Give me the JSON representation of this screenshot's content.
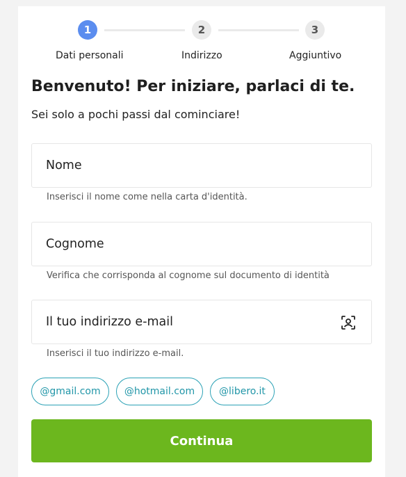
{
  "stepper": {
    "steps": [
      {
        "number": "1",
        "label": "Dati personali"
      },
      {
        "number": "2",
        "label": "Indirizzo"
      },
      {
        "number": "3",
        "label": "Aggiuntivo"
      }
    ],
    "active_step": 1
  },
  "heading": {
    "title": "Benvenuto! Per iniziare, parlaci di te.",
    "subtitle": "Sei solo a pochi passi dal cominciare!"
  },
  "form": {
    "first_name": {
      "placeholder": "Nome",
      "value": "",
      "helper": "Inserisci il nome come nella carta d'identità."
    },
    "last_name": {
      "placeholder": "Cognome",
      "value": "",
      "helper": "Verifica che corrisponda al cognome sul documento di identità"
    },
    "email": {
      "placeholder": "Il tuo indirizzo e-mail",
      "value": "",
      "helper": "Inserisci il tuo indirizzo e-mail.",
      "icon": "contact-icon"
    }
  },
  "email_domains": [
    "@gmail.com",
    "@hotmail.com",
    "@libero.it"
  ],
  "actions": {
    "continue_label": "Continua"
  },
  "colors": {
    "active_step": "#5b8def",
    "chip_accent": "#2aa1b5",
    "primary_button": "#6cb71e"
  }
}
